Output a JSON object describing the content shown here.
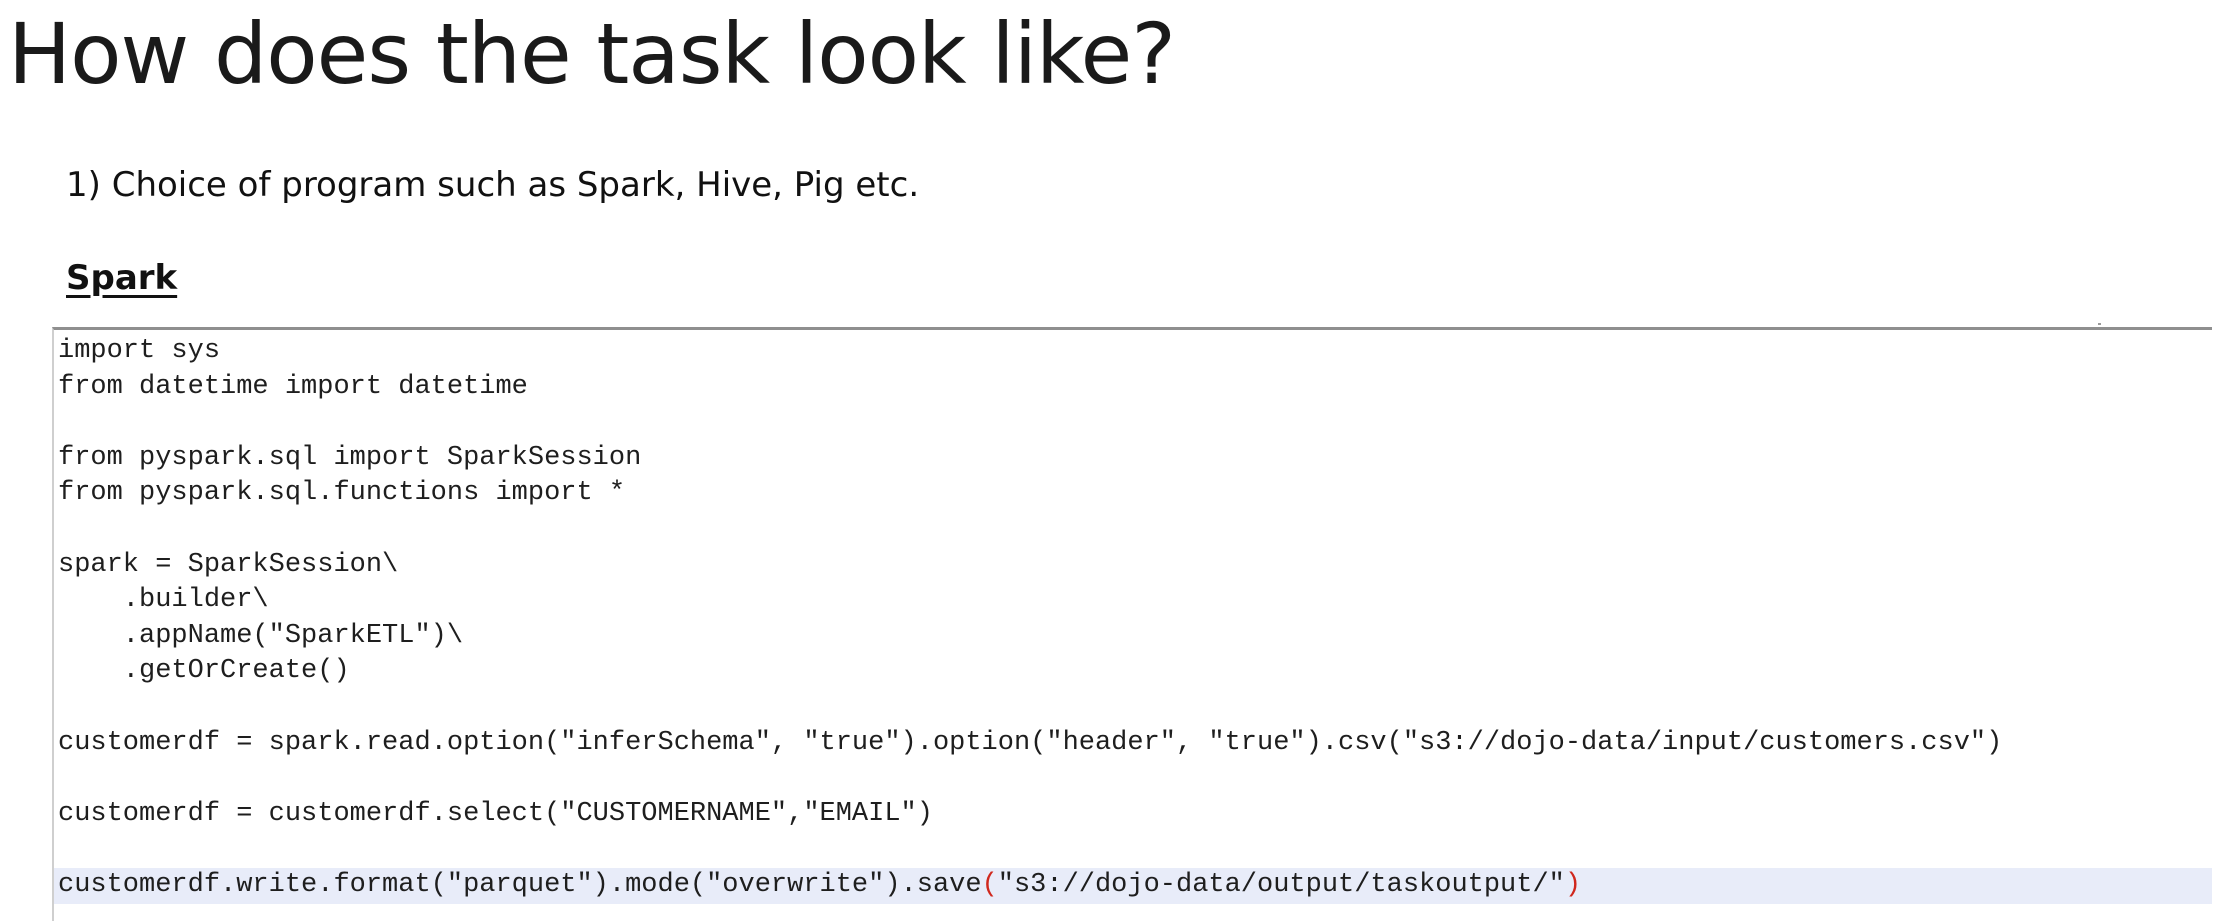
{
  "slide": {
    "title": "How does the task look like?",
    "point": "1) Choice of program such as Spark, Hive, Pig etc.",
    "section_heading": "Spark"
  },
  "code": {
    "lines": [
      "import sys",
      "from datetime import datetime",
      "",
      "from pyspark.sql import SparkSession",
      "from pyspark.sql.functions import *",
      "",
      "spark = SparkSession\\",
      "    .builder\\",
      "    .appName(\"SparkETL\")\\",
      "    .getOrCreate()",
      "",
      "customerdf = spark.read.option(\"inferSchema\", \"true\").option(\"header\", \"true\").csv(\"s3://dojo-data/input/customers.csv\")",
      "",
      "customerdf = customerdf.select(\"CUSTOMERNAME\",\"EMAIL\")",
      ""
    ],
    "last_line": {
      "before": "customerdf.write.format(\"parquet\").mode(\"overwrite\").save",
      "open_paren": "(",
      "argument": "\"s3://dojo-data/output/taskoutput/\"",
      "close_paren": ")"
    },
    "highlight_color": "#e8ecf9",
    "bracket_match_color": "#d0271d"
  }
}
